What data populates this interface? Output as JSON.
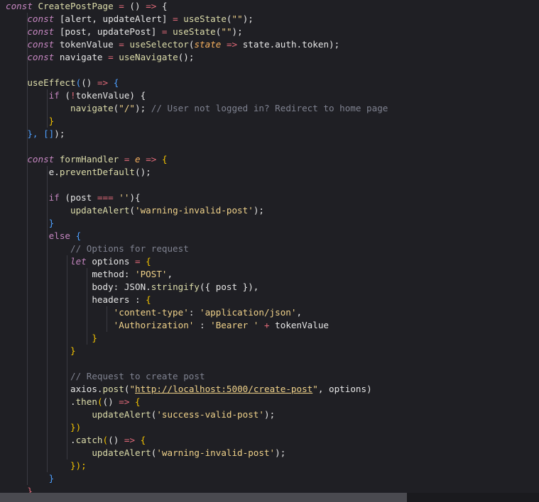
{
  "editor": {
    "lines": [
      [
        {
          "t": "const",
          "c": "kw"
        },
        {
          "t": " CreatePostPage ",
          "c": "fn"
        },
        {
          "t": "=",
          "c": "op"
        },
        {
          "t": " () ",
          "c": "var"
        },
        {
          "t": "=>",
          "c": "op"
        },
        {
          "t": " {",
          "c": "var"
        }
      ],
      [
        {
          "t": "    "
        },
        {
          "t": "const",
          "c": "kw"
        },
        {
          "t": " [alert, updateAlert] ",
          "c": "var"
        },
        {
          "t": "=",
          "c": "op"
        },
        {
          "t": " useState",
          "c": "fn"
        },
        {
          "t": "(",
          "c": "var"
        },
        {
          "t": "\"\"",
          "c": "str"
        },
        {
          "t": ");",
          "c": "var"
        }
      ],
      [
        {
          "t": "    "
        },
        {
          "t": "const",
          "c": "kw"
        },
        {
          "t": " [post, updatePost] ",
          "c": "var"
        },
        {
          "t": "=",
          "c": "op"
        },
        {
          "t": " useState",
          "c": "fn"
        },
        {
          "t": "(",
          "c": "var"
        },
        {
          "t": "\"\"",
          "c": "str"
        },
        {
          "t": ");",
          "c": "var"
        }
      ],
      [
        {
          "t": "    "
        },
        {
          "t": "const",
          "c": "kw"
        },
        {
          "t": " tokenValue ",
          "c": "var"
        },
        {
          "t": "=",
          "c": "op"
        },
        {
          "t": " useSelector",
          "c": "fn"
        },
        {
          "t": "(",
          "c": "var"
        },
        {
          "t": "state",
          "c": "param"
        },
        {
          "t": " ",
          "c": "var"
        },
        {
          "t": "=>",
          "c": "op"
        },
        {
          "t": " state.auth.token);",
          "c": "var"
        }
      ],
      [
        {
          "t": "    "
        },
        {
          "t": "const",
          "c": "kw"
        },
        {
          "t": " navigate ",
          "c": "var"
        },
        {
          "t": "=",
          "c": "op"
        },
        {
          "t": " useNavigate",
          "c": "fn"
        },
        {
          "t": "();",
          "c": "var"
        }
      ],
      [],
      [
        {
          "t": "    "
        },
        {
          "t": "useEffect",
          "c": "fn"
        },
        {
          "t": "(",
          "c": "brk"
        },
        {
          "t": "() ",
          "c": "var"
        },
        {
          "t": "=>",
          "c": "op"
        },
        {
          "t": " {",
          "c": "brk"
        }
      ],
      [
        {
          "t": "        "
        },
        {
          "t": "if",
          "c": "kw2"
        },
        {
          "t": " (",
          "c": "var"
        },
        {
          "t": "!",
          "c": "op"
        },
        {
          "t": "tokenValue) {",
          "c": "var"
        }
      ],
      [
        {
          "t": "            "
        },
        {
          "t": "navigate",
          "c": "fn"
        },
        {
          "t": "(",
          "c": "var"
        },
        {
          "t": "\"/\"",
          "c": "str"
        },
        {
          "t": "); ",
          "c": "var"
        },
        {
          "t": "// User not logged in? Redirect to home page",
          "c": "cmt"
        }
      ],
      [
        {
          "t": "        "
        },
        {
          "t": "}",
          "c": "brk2"
        }
      ],
      [
        {
          "t": "    "
        },
        {
          "t": "}, ",
          "c": "brk"
        },
        {
          "t": "[]",
          "c": "brk"
        },
        {
          "t": ");",
          "c": "var"
        }
      ],
      [],
      [
        {
          "t": "    "
        },
        {
          "t": "const",
          "c": "kw"
        },
        {
          "t": " formHandler ",
          "c": "fn"
        },
        {
          "t": "=",
          "c": "op"
        },
        {
          "t": " ",
          "c": "var"
        },
        {
          "t": "e",
          "c": "param"
        },
        {
          "t": " ",
          "c": "var"
        },
        {
          "t": "=>",
          "c": "op"
        },
        {
          "t": " {",
          "c": "brk2"
        }
      ],
      [
        {
          "t": "        "
        },
        {
          "t": "e.",
          "c": "var"
        },
        {
          "t": "preventDefault",
          "c": "fn"
        },
        {
          "t": "();",
          "c": "var"
        }
      ],
      [],
      [
        {
          "t": "        "
        },
        {
          "t": "if",
          "c": "kw2"
        },
        {
          "t": " (post ",
          "c": "var"
        },
        {
          "t": "===",
          "c": "op"
        },
        {
          "t": " ",
          "c": "var"
        },
        {
          "t": "''",
          "c": "str"
        },
        {
          "t": "){",
          "c": "var"
        }
      ],
      [
        {
          "t": "            "
        },
        {
          "t": "updateAlert",
          "c": "fn"
        },
        {
          "t": "(",
          "c": "var"
        },
        {
          "t": "'warning-invalid-post'",
          "c": "str"
        },
        {
          "t": ");",
          "c": "var"
        }
      ],
      [
        {
          "t": "        "
        },
        {
          "t": "}",
          "c": "brk"
        }
      ],
      [
        {
          "t": "        "
        },
        {
          "t": "else",
          "c": "kw2"
        },
        {
          "t": " {",
          "c": "brk"
        }
      ],
      [
        {
          "t": "            "
        },
        {
          "t": "// Options for request",
          "c": "cmt"
        }
      ],
      [
        {
          "t": "            "
        },
        {
          "t": "let",
          "c": "kw"
        },
        {
          "t": " options ",
          "c": "var"
        },
        {
          "t": "=",
          "c": "op"
        },
        {
          "t": " {",
          "c": "brk2"
        }
      ],
      [
        {
          "t": "                "
        },
        {
          "t": "method: ",
          "c": "var"
        },
        {
          "t": "'POST'",
          "c": "str"
        },
        {
          "t": ",",
          "c": "var"
        }
      ],
      [
        {
          "t": "                "
        },
        {
          "t": "body: JSON.",
          "c": "var"
        },
        {
          "t": "stringify",
          "c": "fn"
        },
        {
          "t": "({ post }),",
          "c": "var"
        }
      ],
      [
        {
          "t": "                "
        },
        {
          "t": "headers : ",
          "c": "var"
        },
        {
          "t": "{",
          "c": "brk2"
        }
      ],
      [
        {
          "t": "                    "
        },
        {
          "t": "'content-type'",
          "c": "str"
        },
        {
          "t": ": ",
          "c": "var"
        },
        {
          "t": "'application/json'",
          "c": "str"
        },
        {
          "t": ",",
          "c": "var"
        }
      ],
      [
        {
          "t": "                    "
        },
        {
          "t": "'Authorization'",
          "c": "str"
        },
        {
          "t": " : ",
          "c": "var"
        },
        {
          "t": "'Bearer '",
          "c": "str"
        },
        {
          "t": " ",
          "c": "var"
        },
        {
          "t": "+",
          "c": "op"
        },
        {
          "t": " tokenValue",
          "c": "var"
        }
      ],
      [
        {
          "t": "                "
        },
        {
          "t": "}",
          "c": "brk2"
        }
      ],
      [
        {
          "t": "            "
        },
        {
          "t": "}",
          "c": "brk2"
        }
      ],
      [],
      [
        {
          "t": "            "
        },
        {
          "t": "// Request to create post",
          "c": "cmt"
        }
      ],
      [
        {
          "t": "            "
        },
        {
          "t": "axios.",
          "c": "var"
        },
        {
          "t": "post",
          "c": "fn"
        },
        {
          "t": "(",
          "c": "var"
        },
        {
          "t": "\"",
          "c": "str"
        },
        {
          "t": "http://localhost:5000/create-post",
          "c": "str url"
        },
        {
          "t": "\"",
          "c": "str"
        },
        {
          "t": ", options)",
          "c": "var"
        }
      ],
      [
        {
          "t": "            "
        },
        {
          "t": ".",
          "c": "var"
        },
        {
          "t": "then",
          "c": "fn"
        },
        {
          "t": "(",
          "c": "brk2"
        },
        {
          "t": "() ",
          "c": "var"
        },
        {
          "t": "=>",
          "c": "op"
        },
        {
          "t": " {",
          "c": "brk2"
        }
      ],
      [
        {
          "t": "                "
        },
        {
          "t": "updateAlert",
          "c": "fn"
        },
        {
          "t": "(",
          "c": "var"
        },
        {
          "t": "'success-valid-post'",
          "c": "str"
        },
        {
          "t": ");",
          "c": "var"
        }
      ],
      [
        {
          "t": "            "
        },
        {
          "t": "})",
          "c": "brk2"
        }
      ],
      [
        {
          "t": "            "
        },
        {
          "t": ".",
          "c": "var"
        },
        {
          "t": "catch",
          "c": "fn"
        },
        {
          "t": "(",
          "c": "brk2"
        },
        {
          "t": "() ",
          "c": "var"
        },
        {
          "t": "=>",
          "c": "op"
        },
        {
          "t": " {",
          "c": "brk2"
        }
      ],
      [
        {
          "t": "                "
        },
        {
          "t": "updateAlert",
          "c": "fn"
        },
        {
          "t": "(",
          "c": "var"
        },
        {
          "t": "'warning-invalid-post'",
          "c": "str"
        },
        {
          "t": ");",
          "c": "var"
        }
      ],
      [
        {
          "t": "            "
        },
        {
          "t": "});",
          "c": "brk2"
        }
      ],
      [
        {
          "t": "        "
        },
        {
          "t": "}",
          "c": "brk"
        }
      ],
      [
        {
          "t": "    "
        },
        {
          "t": "}",
          "c": "op"
        }
      ]
    ]
  }
}
